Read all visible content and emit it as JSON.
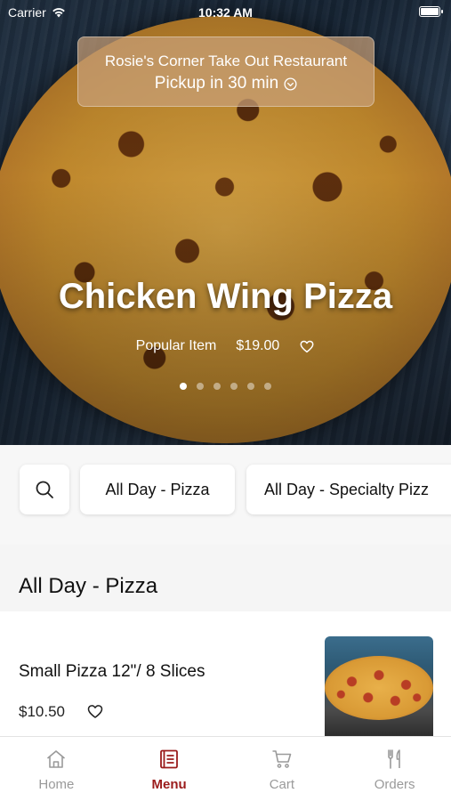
{
  "status_bar": {
    "carrier": "Carrier",
    "time": "10:32 AM"
  },
  "restaurant": {
    "name": "Rosie's Corner Take Out Restaurant",
    "pickup": "Pickup in 30 min"
  },
  "featured": {
    "title": "Chicken Wing Pizza",
    "tag": "Popular Item",
    "price": "$19.00",
    "slides": 6,
    "active_slide": 1
  },
  "categories": {
    "items": [
      "All Day - Pizza",
      "All Day - Specialty Pizza"
    ],
    "visible_text": [
      "All Day - Pizza",
      "All Day - Specialty Pizz"
    ]
  },
  "section": {
    "title": "All Day - Pizza"
  },
  "menu_items": [
    {
      "name": "Small Pizza 12\"/ 8 Slices",
      "price": "$10.50"
    }
  ],
  "tabs": [
    {
      "label": "Home",
      "icon": "home-icon",
      "active": false
    },
    {
      "label": "Menu",
      "icon": "menu-icon",
      "active": true
    },
    {
      "label": "Cart",
      "icon": "cart-icon",
      "active": false
    },
    {
      "label": "Orders",
      "icon": "orders-icon",
      "active": false
    }
  ],
  "colors": {
    "accent": "#9b1c1c",
    "inactive_tab": "#9a9a9a"
  }
}
